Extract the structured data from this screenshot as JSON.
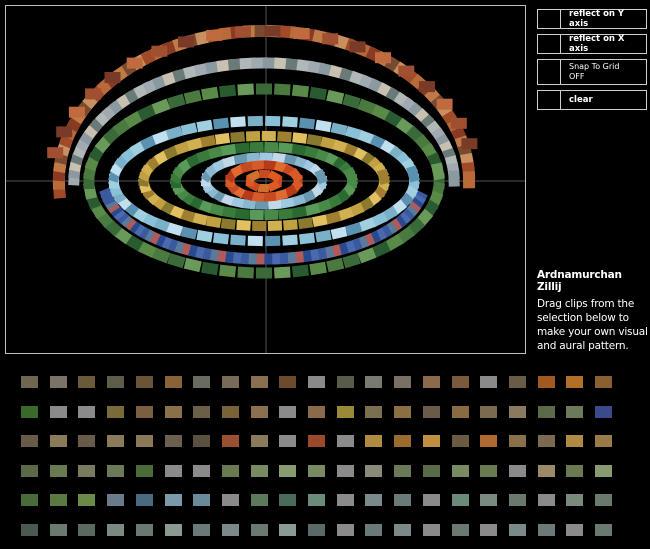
{
  "controls": {
    "reflect_y": "reflect on Y axis",
    "reflect_x": "reflect on X axis",
    "snap_to_grid": "Snap To Grid\nOFF",
    "clear": "clear"
  },
  "info": {
    "title": "Ardnamurchan Zillij",
    "description": "Drag clips from the selection below to make your own visual and aural pattern."
  },
  "palette_colors": {
    "row1": [
      "#6e6650",
      "#7a7468",
      "#6b5a3a",
      "#5d5d4a",
      "#6a5438",
      "#8a6238",
      "#6a6a60",
      "#7a6a58",
      "#8a7050",
      "#6c4a2c",
      "#8a8a8a",
      "#5a5a48",
      "#7a7a70",
      "#787062",
      "#8a6a48",
      "#7a5a3a",
      "#8a8a8a",
      "#6a5a48",
      "#a05a20",
      "#b0702a",
      "#8a6030"
    ],
    "row2": [
      "#3a6a2a",
      "#8a8a8a",
      "#8a8a8a",
      "#7a6a3a",
      "#7a6040",
      "#8a7048",
      "#6a6048",
      "#7a6238",
      "#8a7050",
      "#8a8a8a",
      "#8a6a48",
      "#9a8a38",
      "#7a7050",
      "#8a7040",
      "#6a5a4a",
      "#8a6a40",
      "#7a6a50",
      "#8a7a60",
      "#5a6a4a",
      "#6a7a5a",
      "#3a4a8a"
    ],
    "row3": [
      "#6a5a48",
      "#8a7a58",
      "#6a5a48",
      "#8a7a58",
      "#8a7858",
      "#6a6050",
      "#5a5040",
      "#9a5030",
      "#8a7a5a",
      "#8a8a8a",
      "#9a4a2a",
      "#8a8a8a",
      "#b08a40",
      "#9a6a30",
      "#c09040",
      "#6a5a40",
      "#b06a30",
      "#8a7048",
      "#7a6a50",
      "#b08a40",
      "#9a7a48"
    ],
    "row4": [
      "#5a6a48",
      "#6a7a50",
      "#7a7a60",
      "#6a7a58",
      "#4a6a3a",
      "#8a8a8a",
      "#8a8a8a",
      "#6a7a50",
      "#7a8a60",
      "#8a9a70",
      "#7a8a60",
      "#8a8a8a",
      "#8a8a78",
      "#6a7a58",
      "#5a6a48",
      "#7a8a60",
      "#6a7a50",
      "#8a8a8a",
      "#9a8a68",
      "#6a7a50",
      "#8a9a70"
    ],
    "row5": [
      "#4a6a3a",
      "#5a7a40",
      "#6a8a48",
      "#6a7a8a",
      "#4a6a80",
      "#7a9aaa",
      "#6a8a9a",
      "#8a8a8a",
      "#5a7a5a",
      "#4a6a5a",
      "#6a8a7a",
      "#8a8a8a",
      "#7a8a8a",
      "#6a7a78",
      "#8a8a8a",
      "#6a8a7a",
      "#7a8a80",
      "#6a7a6a",
      "#8a8a8a",
      "#7a8a7a",
      "#6a7a6a"
    ],
    "row6": [
      "#4a5a50",
      "#6a7a70",
      "#5a6a60",
      "#7a8a80",
      "#6a7a70",
      "#8a9a90",
      "#6a7a78",
      "#7a8a88",
      "#6a7a70",
      "#8a9a98",
      "#5a6a68",
      "#8a8a8a",
      "#6a7a78",
      "#7a8a88",
      "#8a8a8a",
      "#6a7a70",
      "#8a8a8a",
      "#7a8a88",
      "#6a7a78",
      "#8a8a8a",
      "#6a7a70"
    ]
  }
}
